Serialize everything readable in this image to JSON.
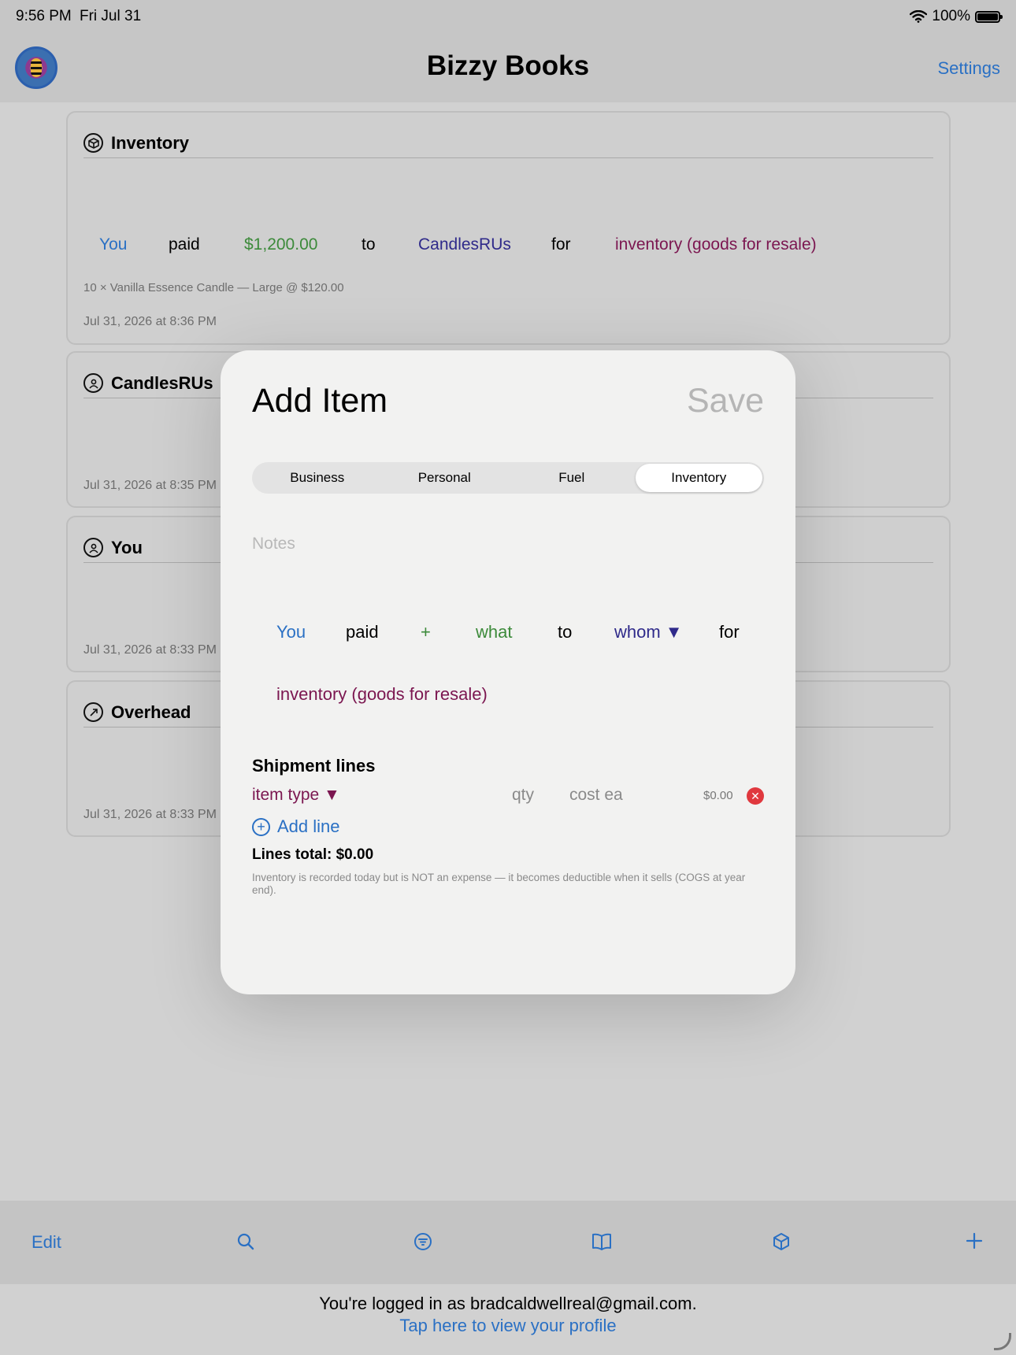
{
  "status_bar": {
    "time": "9:56 PM",
    "date": "Fri Jul 31",
    "battery": "100%",
    "battery_level": 1.0
  },
  "nav": {
    "title": "Bizzy Books",
    "settings_label": "Settings"
  },
  "cards": [
    {
      "title": "Inventory",
      "icon": "cube-icon",
      "sentence": {
        "who": "You",
        "verb": "paid",
        "amount": "$1,200.00",
        "to": "to",
        "vendor": "CandlesRUs",
        "for": "for",
        "category": "inventory (goods for resale)"
      },
      "line": "10 × Vanilla Essence Candle — Large @ $120.00",
      "date": "Jul 31, 2026 at 8:36 PM"
    },
    {
      "title": "CandlesRUs",
      "icon": "person-circle-icon",
      "date": "Jul 31, 2026 at 8:35 PM"
    },
    {
      "title": "You",
      "icon": "person-circle-icon",
      "date": "Jul 31, 2026 at 8:33 PM"
    },
    {
      "title": "Overhead",
      "icon": "arrow-circle-icon",
      "date": "Jul 31, 2026 at 8:33 PM"
    }
  ],
  "modal": {
    "title": "Add Item",
    "save_label": "Save",
    "segments": [
      "Business",
      "Personal",
      "Fuel",
      "Inventory"
    ],
    "selected_segment": "Inventory",
    "notes_placeholder": "Notes",
    "sentence": {
      "who": "You",
      "verb": "paid",
      "plus": "+",
      "what": "what",
      "to": "to",
      "whom": "whom ▼",
      "for": "for",
      "category": "inventory (goods for resale)"
    },
    "shipment_title": "Shipment lines",
    "line": {
      "item_type": "item type ▼",
      "qty_placeholder": "qty",
      "cost_placeholder": "cost ea",
      "line_cost": "$0.00"
    },
    "add_line_label": "Add line",
    "lines_total": "Lines total: $0.00",
    "inventory_note": "Inventory is recorded today but is NOT an expense — it becomes deductible when it sells (COGS at year end)."
  },
  "toolbar": {
    "edit_label": "Edit",
    "icons": [
      "search-icon",
      "filter-icon",
      "book-icon",
      "cube-icon",
      "plus-icon"
    ]
  },
  "footer": {
    "logged_in": "You're logged in as bradcaldwellreal@gmail.com.",
    "profile_link": "Tap here to view your profile"
  },
  "colors": {
    "accent": "#2a70c4",
    "amount_green": "#3c8a3a",
    "vendor_indigo": "#2f2a8a",
    "category_maroon": "#7b1650",
    "remove_red": "#e0383e"
  }
}
